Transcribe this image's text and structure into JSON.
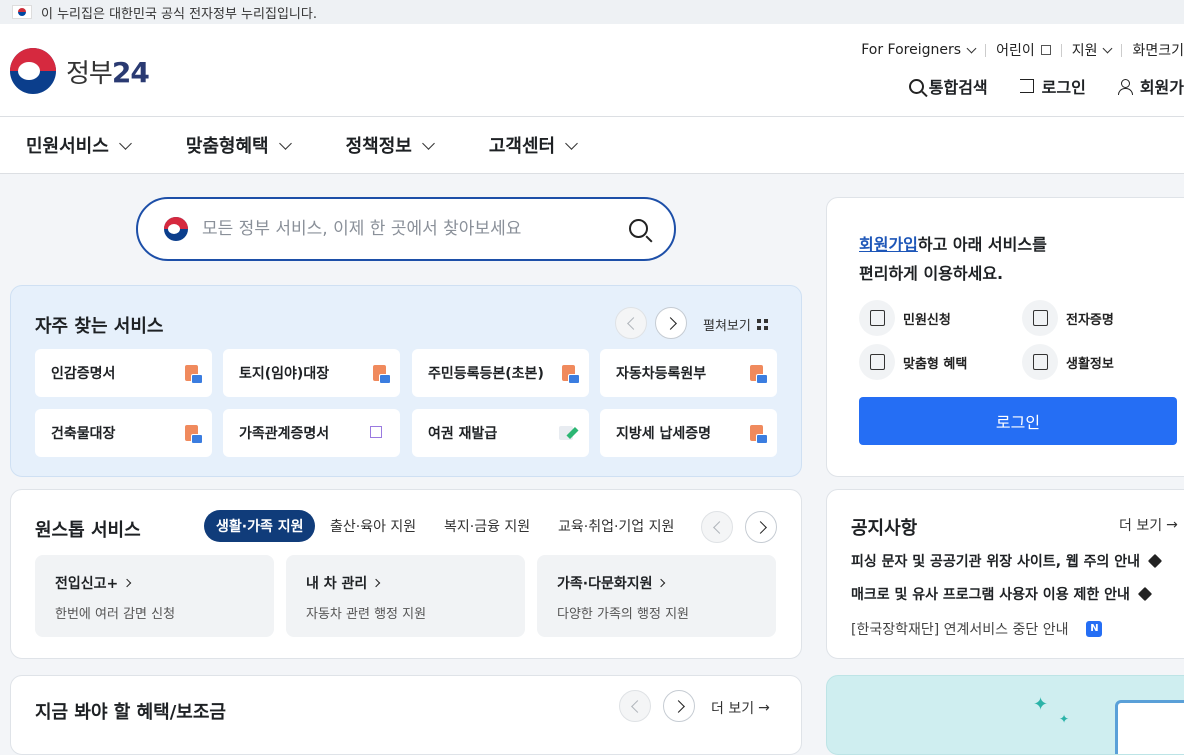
{
  "banner": {
    "text": "이 누리집은 대한민국 공식 전자정부 누리집입니다."
  },
  "logo": {
    "name": "정부",
    "number": "24"
  },
  "utility": {
    "foreigners": "For Foreigners",
    "kids": "어린이",
    "support": "지원",
    "screen": "화면크기"
  },
  "actions": {
    "search": "통합검색",
    "login": "로그인",
    "signup": "회원가"
  },
  "gnb": [
    "민원서비스",
    "맞춤형혜택",
    "정책정보",
    "고객센터"
  ],
  "search": {
    "placeholder": "모든 정부 서비스, 이제 한 곳에서 찾아보세요"
  },
  "frequent": {
    "title": "자주 찾는 서비스",
    "expand": "펼쳐보기",
    "items": [
      {
        "label": "인감증명서",
        "icon": "pdf-icon"
      },
      {
        "label": "토지(임야)대장",
        "icon": "pdf-icon"
      },
      {
        "label": "주민등록등본(초본)",
        "icon": "pdf-icon"
      },
      {
        "label": "자동차등록원부",
        "icon": "pdf-icon"
      },
      {
        "label": "건축물대장",
        "icon": "pdf-icon"
      },
      {
        "label": "가족관계증명서",
        "icon": "external-link-icon"
      },
      {
        "label": "여권 재발급",
        "icon": "edit-icon"
      },
      {
        "label": "지방세 납세증명",
        "icon": "pdf-icon"
      }
    ]
  },
  "onestop": {
    "title": "원스톱 서비스",
    "tabs": [
      "생활·가족 지원",
      "출산·육아 지원",
      "복지·금융 지원",
      "교육·취업·기업 지원"
    ],
    "cards": [
      {
        "title": "전입신고+",
        "desc": "한번에 여러 감면 신청"
      },
      {
        "title": "내 차 관리",
        "desc": "자동차 관련 행정 지원"
      },
      {
        "title": "가족·다문화지원",
        "desc": "다양한 가족의 행정 지원"
      }
    ]
  },
  "benefit": {
    "title": "지금 봐야 할 혜택/보조금",
    "more": "더 보기"
  },
  "member": {
    "highlight": "회원가입",
    "line1_rest": "하고 아래 서비스를",
    "line2": "편리하게 이용하세요.",
    "features": [
      "민원신청",
      "전자증명",
      "맞춤형 혜택",
      "생활정보"
    ],
    "login_button": "로그인"
  },
  "notice": {
    "title": "공지사항",
    "more": "더 보기",
    "items": [
      "피싱 문자 및 공공기관 위장 사이트, 웹 주의 안내",
      "매크로 및 유사 프로그램 사용자 이용 제한 안내",
      "[한국장학재단] 연계서비스 중단 안내"
    ],
    "new_badge": "N"
  },
  "colors": {
    "primary": "#256ef4",
    "navy": "#103c7a",
    "freq_bg": "#e6f0fb"
  }
}
